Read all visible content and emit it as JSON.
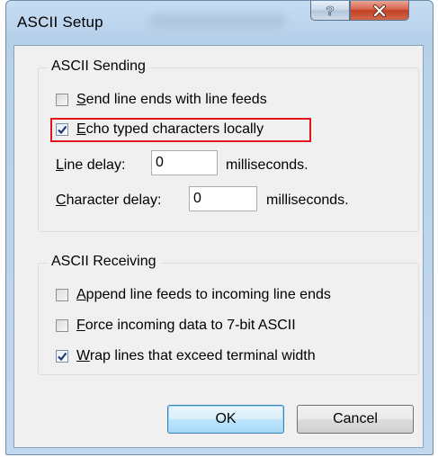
{
  "window": {
    "title": "ASCII Setup",
    "help_glyph": "?",
    "close_glyph": "✕"
  },
  "ascii_sending": {
    "group_title": "ASCII Sending",
    "send_line_ends": {
      "mnemonic": "S",
      "rest": "end line ends with line feeds",
      "checked": false
    },
    "echo_typed": {
      "mnemonic": "E",
      "rest": "cho typed characters locally",
      "checked": true
    },
    "line_delay": {
      "mnemonic": "L",
      "rest": "ine delay:",
      "value": "0",
      "unit": "milliseconds."
    },
    "character_delay": {
      "mnemonic": "C",
      "rest": "haracter delay:",
      "value": "0",
      "unit": "milliseconds."
    }
  },
  "ascii_receiving": {
    "group_title": "ASCII Receiving",
    "append_line_feeds": {
      "mnemonic": "A",
      "rest": "ppend line feeds to incoming line ends",
      "checked": false
    },
    "force_7bit": {
      "mnemonic": "F",
      "rest": "orce incoming data to 7-bit ASCII",
      "checked": false
    },
    "wrap_lines": {
      "mnemonic": "W",
      "rest": "rap lines that exceed terminal width",
      "checked": true
    }
  },
  "buttons": {
    "ok": "OK",
    "cancel": "Cancel"
  },
  "colors": {
    "highlight_border": "#e1131b",
    "close_button": "#c23e22"
  }
}
